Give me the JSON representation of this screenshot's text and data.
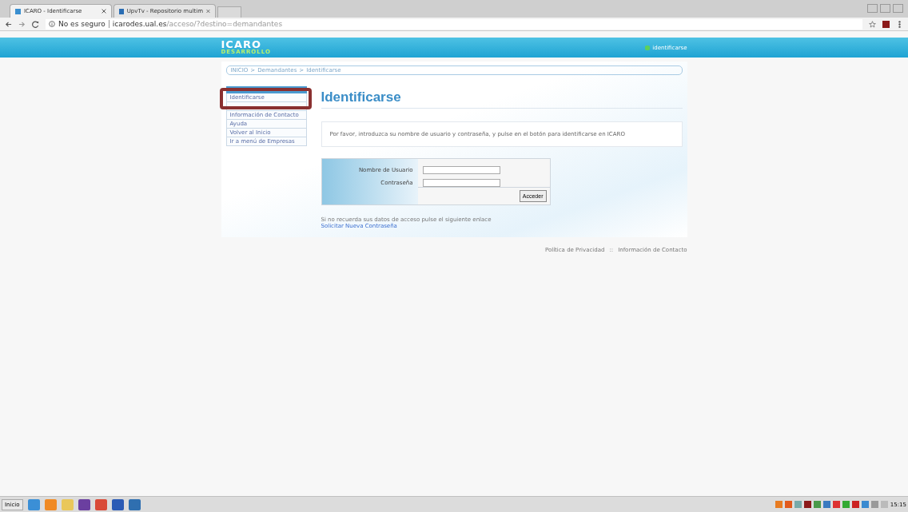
{
  "browser": {
    "tabs": [
      {
        "title": "ICARO - Identificarse",
        "selected": true
      },
      {
        "title": "UpvTv - Repositorio multim",
        "selected": false
      }
    ],
    "security": "No es seguro",
    "url_host": "icarodes.ual.es",
    "url_path": "/acceso/?destino=demandantes"
  },
  "site": {
    "logo": "ICARO",
    "logo_sub": "DESARROLLO",
    "login_link": "identificarse",
    "breadcrumb": [
      "INICIO",
      "Demandantes",
      "Identificarse"
    ],
    "breadcrumb_separator": ">",
    "sidebar": {
      "items": [
        {
          "kind": "link",
          "label": "Identificarse",
          "highlighted": true
        },
        {
          "kind": "obscured"
        },
        {
          "kind": "link",
          "label": "Información de Contacto",
          "highlighted": false
        },
        {
          "kind": "link",
          "label": "Ayuda",
          "highlighted": false
        },
        {
          "kind": "link",
          "label": "Volver al Inicio",
          "highlighted": false
        },
        {
          "kind": "link",
          "label": "Ir a menú de Empresas",
          "highlighted": false
        }
      ]
    },
    "title": "Identificarse",
    "intro": "Por favor, introduzca su nombre de usuario y contraseña, y pulse en el botón para identificarse en ICARO",
    "form": {
      "fields": [
        {
          "label": "Nombre de Usuario"
        },
        {
          "label": "Contraseña"
        }
      ],
      "submit": "Acceder"
    },
    "recover_text": "Si no recuerda sus datos de acceso pulse el siguiente enlace",
    "recover_link": "Solicitar Nueva Contraseña",
    "footer_links": [
      "Política de Privacidad",
      "Información de Contacto"
    ],
    "footer_separator": "::"
  },
  "taskbar": {
    "start": "Inicio",
    "clock": "15:15"
  }
}
